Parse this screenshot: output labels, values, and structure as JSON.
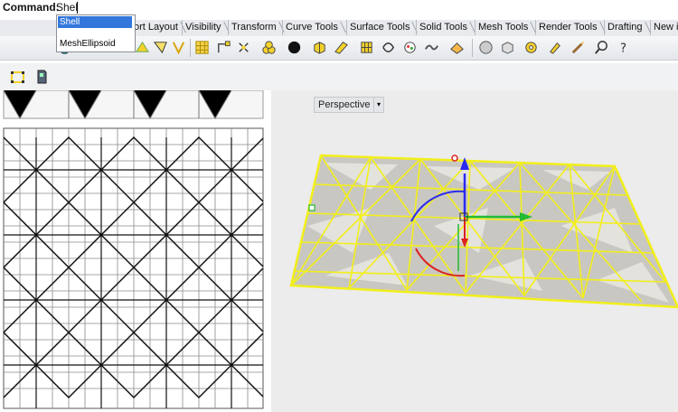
{
  "command": {
    "label": "Command:",
    "value": "Shel"
  },
  "autocomplete": {
    "options": [
      "Shell",
      "MeshEllipsoid"
    ]
  },
  "tabs": [
    "ort Layout",
    "Visibility",
    "Transform",
    "Curve Tools",
    "Surface Tools",
    "Solid Tools",
    "Mesh Tools",
    "Render Tools",
    "Drafting",
    "New i"
  ],
  "viewport": {
    "title": "Perspective",
    "dropdown_glyph": "▾"
  },
  "colors": {
    "selection_yellow": "#f2ef1a",
    "accent": "#3377dd",
    "grid_line": "#111111"
  },
  "toolbar_icons": [
    "sphere-icon",
    "box-icon",
    "cylinder-icon",
    "shell-icon",
    "cone-icon",
    "solid-icon",
    "surface-icon",
    "grid-icon",
    "gumball-icon",
    "lock-icon",
    "curve-icon",
    "point-icon",
    "edit-icon",
    "mesh-icon",
    "rotate-icon",
    "move-icon",
    "lasso-icon",
    "scale-icon",
    "dot-icon",
    "cube-icon",
    "cylinder-yellow-icon",
    "wedge-icon",
    "plate-icon",
    "group-icon",
    "chain-icon",
    "snake-icon",
    "cone-yellow-icon",
    "sphere-gray-icon",
    "box-gray-icon",
    "gear-icon",
    "paint-icon",
    "brush-icon",
    "zoom-icon",
    "help-icon"
  ],
  "toolbar2_icons": [
    "select-points-icon",
    "block-icon"
  ]
}
